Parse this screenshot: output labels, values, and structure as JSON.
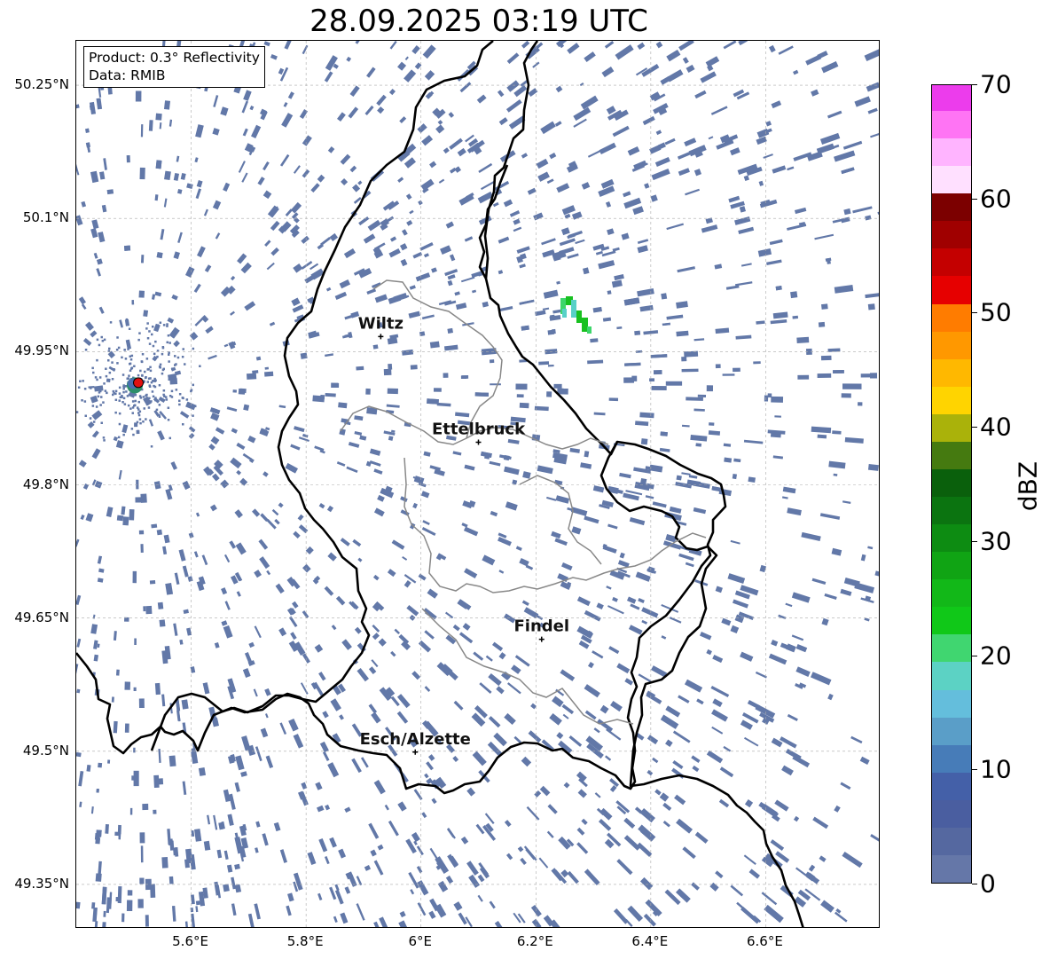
{
  "title": "28.09.2025 03:19 UTC",
  "info": {
    "product": "Product: 0.3° Reflectivity",
    "data": "Data: RMIB"
  },
  "map": {
    "lon_range": [
      5.4,
      6.8
    ],
    "lat_range": [
      49.3,
      50.3
    ],
    "lat_ticks": [
      {
        "value": 50.25,
        "label": "50.25°N"
      },
      {
        "value": 50.1,
        "label": "50.1°N"
      },
      {
        "value": 49.95,
        "label": "49.95°N"
      },
      {
        "value": 49.8,
        "label": "49.8°N"
      },
      {
        "value": 49.65,
        "label": "49.65°N"
      },
      {
        "value": 49.5,
        "label": "49.5°N"
      },
      {
        "value": 49.35,
        "label": "49.35°N"
      }
    ],
    "lon_ticks": [
      {
        "value": 5.6,
        "label": "5.6°E"
      },
      {
        "value": 5.8,
        "label": "5.8°E"
      },
      {
        "value": 6.0,
        "label": "6°E"
      },
      {
        "value": 6.2,
        "label": "6.2°E"
      },
      {
        "value": 6.4,
        "label": "6.4°E"
      },
      {
        "value": 6.6,
        "label": "6.6°E"
      }
    ],
    "gridlines": true,
    "radar_site": {
      "lon": 5.505,
      "lat": 49.914
    },
    "cities": [
      {
        "name": "Wiltz",
        "lon": 5.93,
        "lat": 49.967
      },
      {
        "name": "Ettelbruck",
        "lon": 6.1,
        "lat": 49.848
      },
      {
        "name": "Findel",
        "lon": 6.21,
        "lat": 49.626
      },
      {
        "name": "Esch/Alzette",
        "lon": 5.99,
        "lat": 49.499
      }
    ],
    "echo_color": "#6278a8",
    "cell_colors": [
      "#18c020",
      "#3dd66a",
      "#58d0c8"
    ]
  },
  "colorbar": {
    "unit": "dBZ",
    "min": 0,
    "max": 70,
    "ticks": [
      {
        "value": 0,
        "label": "0"
      },
      {
        "value": 10,
        "label": "10"
      },
      {
        "value": 20,
        "label": "20"
      },
      {
        "value": 30,
        "label": "30"
      },
      {
        "value": 40,
        "label": "40"
      },
      {
        "value": 50,
        "label": "50"
      },
      {
        "value": 60,
        "label": "60"
      },
      {
        "value": 70,
        "label": "70"
      }
    ],
    "colors": [
      "#6577a8",
      "#5568a0",
      "#4a5ea0",
      "#4460a8",
      "#477cb8",
      "#5a9ec8",
      "#64bedc",
      "#5cd2c4",
      "#40d670",
      "#10c818",
      "#12b818",
      "#10a414",
      "#0d8c12",
      "#0b7410",
      "#0a600c",
      "#457a10",
      "#aab20a",
      "#ffd400",
      "#ffb800",
      "#ff9800",
      "#ff7c00",
      "#e60000",
      "#c40000",
      "#a00000",
      "#7c0000",
      "#ffe0ff",
      "#ffb4ff",
      "#ff74f4",
      "#ec3cec"
    ]
  }
}
